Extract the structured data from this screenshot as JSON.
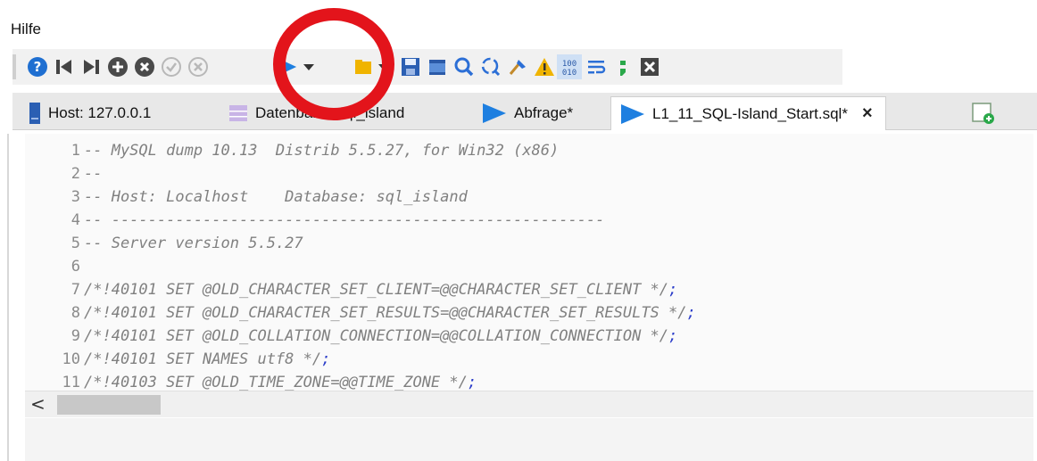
{
  "menu": {
    "items": [
      {
        "label": "Hilfe"
      }
    ]
  },
  "toolbar": {
    "buttons": [
      {
        "name": "help-icon"
      },
      {
        "name": "first-icon"
      },
      {
        "name": "last-icon"
      },
      {
        "name": "add-icon"
      },
      {
        "name": "delete-icon"
      },
      {
        "name": "check-icon"
      },
      {
        "name": "cancel-icon"
      },
      {
        "name": "execute-play-icon"
      },
      {
        "name": "dropdown-arrow-icon"
      },
      {
        "name": "folder-icon"
      },
      {
        "name": "save-icon"
      },
      {
        "name": "layout-icon"
      },
      {
        "name": "find-icon"
      },
      {
        "name": "replace-icon"
      },
      {
        "name": "format-icon"
      },
      {
        "name": "warning-icon"
      },
      {
        "name": "binary-icon"
      },
      {
        "name": "wrap-icon"
      },
      {
        "name": "semicolon-icon"
      },
      {
        "name": "close-box-icon"
      }
    ],
    "highlight_color": "#e3141b"
  },
  "tabs": [
    {
      "label": "Host: 127.0.0.1",
      "icon": "server-icon",
      "active": false
    },
    {
      "label": "Datenbank: sql_island",
      "icon": "database-icon",
      "active": false
    },
    {
      "label": "Abfrage*",
      "icon": "query-icon",
      "active": false
    },
    {
      "label": "L1_11_SQL-Island_Start.sql*",
      "icon": "query-icon",
      "active": true,
      "close": "×"
    }
  ],
  "editor": {
    "lines": [
      {
        "n": "1",
        "text": "-- MySQL dump 10.13  Distrib 5.5.27, for Win32 (x86)"
      },
      {
        "n": "2",
        "text": "--"
      },
      {
        "n": "3",
        "text": "-- Host: Localhost    Database: sql_island"
      },
      {
        "n": "4",
        "text": "-- ------------------------------------------------------"
      },
      {
        "n": "5",
        "text": "-- Server version 5.5.27"
      },
      {
        "n": "6",
        "text": ""
      },
      {
        "n": "7",
        "text": "/*!40101 SET @OLD_CHARACTER_SET_CLIENT=@@CHARACTER_SET_CLIENT */",
        "semi": ";"
      },
      {
        "n": "8",
        "text": "/*!40101 SET @OLD_CHARACTER_SET_RESULTS=@@CHARACTER_SET_RESULTS */",
        "semi": ";"
      },
      {
        "n": "9",
        "text": "/*!40101 SET @OLD_COLLATION_CONNECTION=@@COLLATION_CONNECTION */",
        "semi": ";"
      },
      {
        "n": "10",
        "text": "/*!40101 SET NAMES utf8 */",
        "semi": ";"
      },
      {
        "n": "11",
        "text": "/*!40103 SET @OLD_TIME_ZONE=@@TIME_ZONE */",
        "semi": ";"
      }
    ]
  },
  "scrollbar": {
    "left_arrow": "<"
  }
}
